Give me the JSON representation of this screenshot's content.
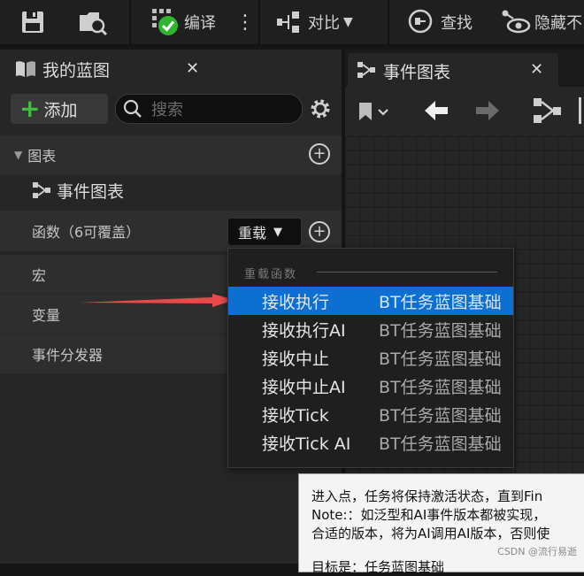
{
  "toolbar": {
    "compile_label": "编译",
    "diff_label": "对比",
    "find_label": "查找",
    "hide_label": "隐藏不"
  },
  "my_blueprint": {
    "tab_title": "我的蓝图",
    "add_label": "添加",
    "search_placeholder": "搜索",
    "sections": {
      "graphs": "图表",
      "event_graph_item": "事件图表",
      "functions": "函数（6可覆盖）",
      "overload_label": "重载",
      "macros": "宏",
      "variables": "变量",
      "event_dispatchers": "事件分发器"
    }
  },
  "graph_tab": {
    "title": "事件图表"
  },
  "overload_menu": {
    "header": "重载函数",
    "items": [
      {
        "name": "接收执行",
        "source": "BT任务蓝图基础",
        "selected": true
      },
      {
        "name": "接收执行AI",
        "source": "BT任务蓝图基础",
        "selected": false
      },
      {
        "name": "接收中止",
        "source": "BT任务蓝图基础",
        "selected": false
      },
      {
        "name": "接收中止AI",
        "source": "BT任务蓝图基础",
        "selected": false
      },
      {
        "name": "接收Tick",
        "source": "BT任务蓝图基础",
        "selected": false
      },
      {
        "name": "接收Tick AI",
        "source": "BT任务蓝图基础",
        "selected": false
      }
    ]
  },
  "tooltip": {
    "line1": "进入点，任务将保持激活状态，直到Fin",
    "line2": "Note:：如泛型和AI事件版本都被实现，",
    "line3": "合适的版本，将为AI调用AI版本，否则使",
    "line4": "目标是：任务蓝图基础"
  },
  "watermark": "CSDN @流行易逝",
  "colors": {
    "selection": "#0e6fd3",
    "add_plus": "#3fbf3f",
    "compile_check": "#2fb52f",
    "arrow": "#e84a4a"
  }
}
